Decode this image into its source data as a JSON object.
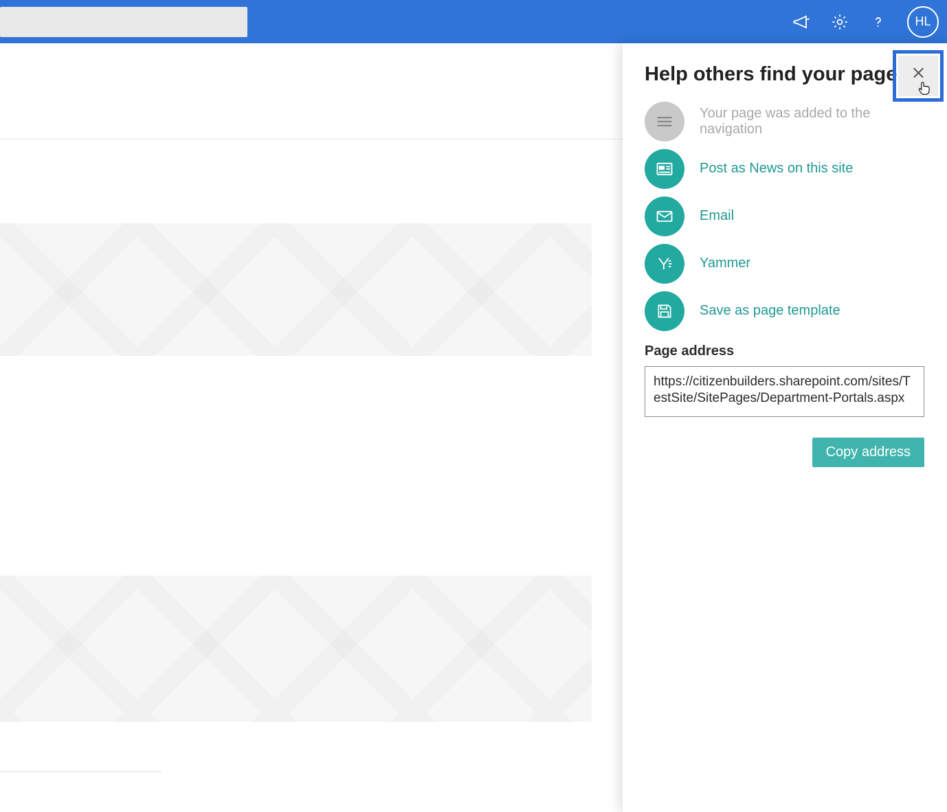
{
  "topbar": {
    "search_value": "",
    "avatar_initials": "HL"
  },
  "panel": {
    "title": "Help others find your page",
    "options": {
      "navigation_added": {
        "label": "Your page was added to the navigation"
      },
      "post_news": {
        "label": "Post as News on this site"
      },
      "email": {
        "label": "Email"
      },
      "yammer": {
        "label": "Yammer"
      },
      "save_template": {
        "label": "Save as page template"
      }
    },
    "page_address_label": "Page address",
    "page_address_value": "https://citizenbuilders.sharepoint.com/sites/TestSite/SitePages/Department-Portals.aspx",
    "copy_button_label": "Copy address"
  }
}
